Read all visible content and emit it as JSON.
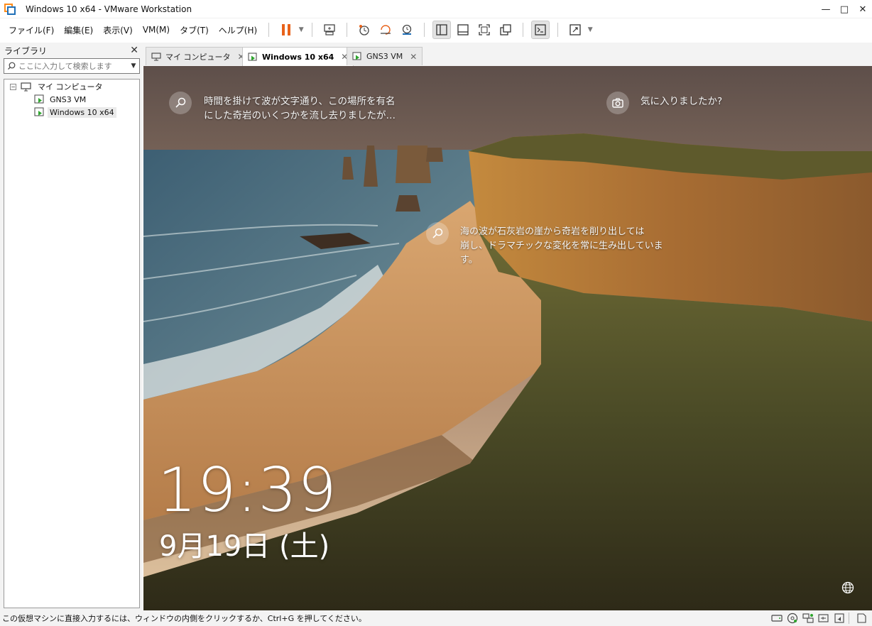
{
  "window": {
    "title": "Windows 10 x64 - VMware Workstation",
    "controls": [
      "—",
      "□",
      "✕"
    ]
  },
  "menu": {
    "items": [
      "ファイル(F)",
      "編集(E)",
      "表示(V)",
      "VM(M)",
      "タブ(T)",
      "ヘルプ(H)"
    ]
  },
  "toolbar": {
    "icons": [
      "pause-icon",
      "send-ctrl-alt-del-icon",
      "snapshot-icon",
      "revert-snapshot-icon",
      "snapshot-manager-icon",
      "show-library-icon",
      "thumbnail-bar-icon",
      "full-screen-icon",
      "unity-icon",
      "console-view-icon",
      "stretch-guest-icon"
    ],
    "accent": "#e8621a"
  },
  "library": {
    "title": "ライブラリ",
    "close": "✕",
    "search_placeholder": "ここに入力して検索します",
    "tree": {
      "root": "マイ コンピュータ",
      "expander": "−",
      "children": [
        "GNS3 VM",
        "Windows 10 x64"
      ],
      "selected": "Windows 10 x64"
    }
  },
  "tabs": [
    {
      "label": "マイ コンピュータ",
      "active": false
    },
    {
      "label": "Windows 10 x64",
      "active": true
    },
    {
      "label": "GNS3 VM",
      "active": false
    }
  ],
  "lockscreen": {
    "spotlight_top": "時間を掛けて波が文字通り、この場所を有名にした奇岩のいくつかを流し去りましたが…",
    "spotlight_top_line1": "時間を掛けて波が文字通り、この場所を有名",
    "spotlight_top_line2": "にした奇岩のいくつかを流し去りましたが…",
    "like_prompt": "気に入りましたか?",
    "spotlight_mid_line1": "海の波が石灰岩の崖から奇岩を削り出しては",
    "spotlight_mid_line2": "崩し、ドラマチックな変化を常に生み出していま",
    "spotlight_mid_line3": "す。",
    "time": "19:39",
    "date": "9月19日 (土)"
  },
  "statusbar": {
    "message": "この仮想マシンに直接入力するには、ウィンドウの内側をクリックするか、Ctrl+G を押してください。",
    "icons": [
      "hard-disk-icon",
      "cd-dvd-icon",
      "network-adapter-icon",
      "usb-icon",
      "sound-card-icon",
      "message-log-icon"
    ]
  }
}
